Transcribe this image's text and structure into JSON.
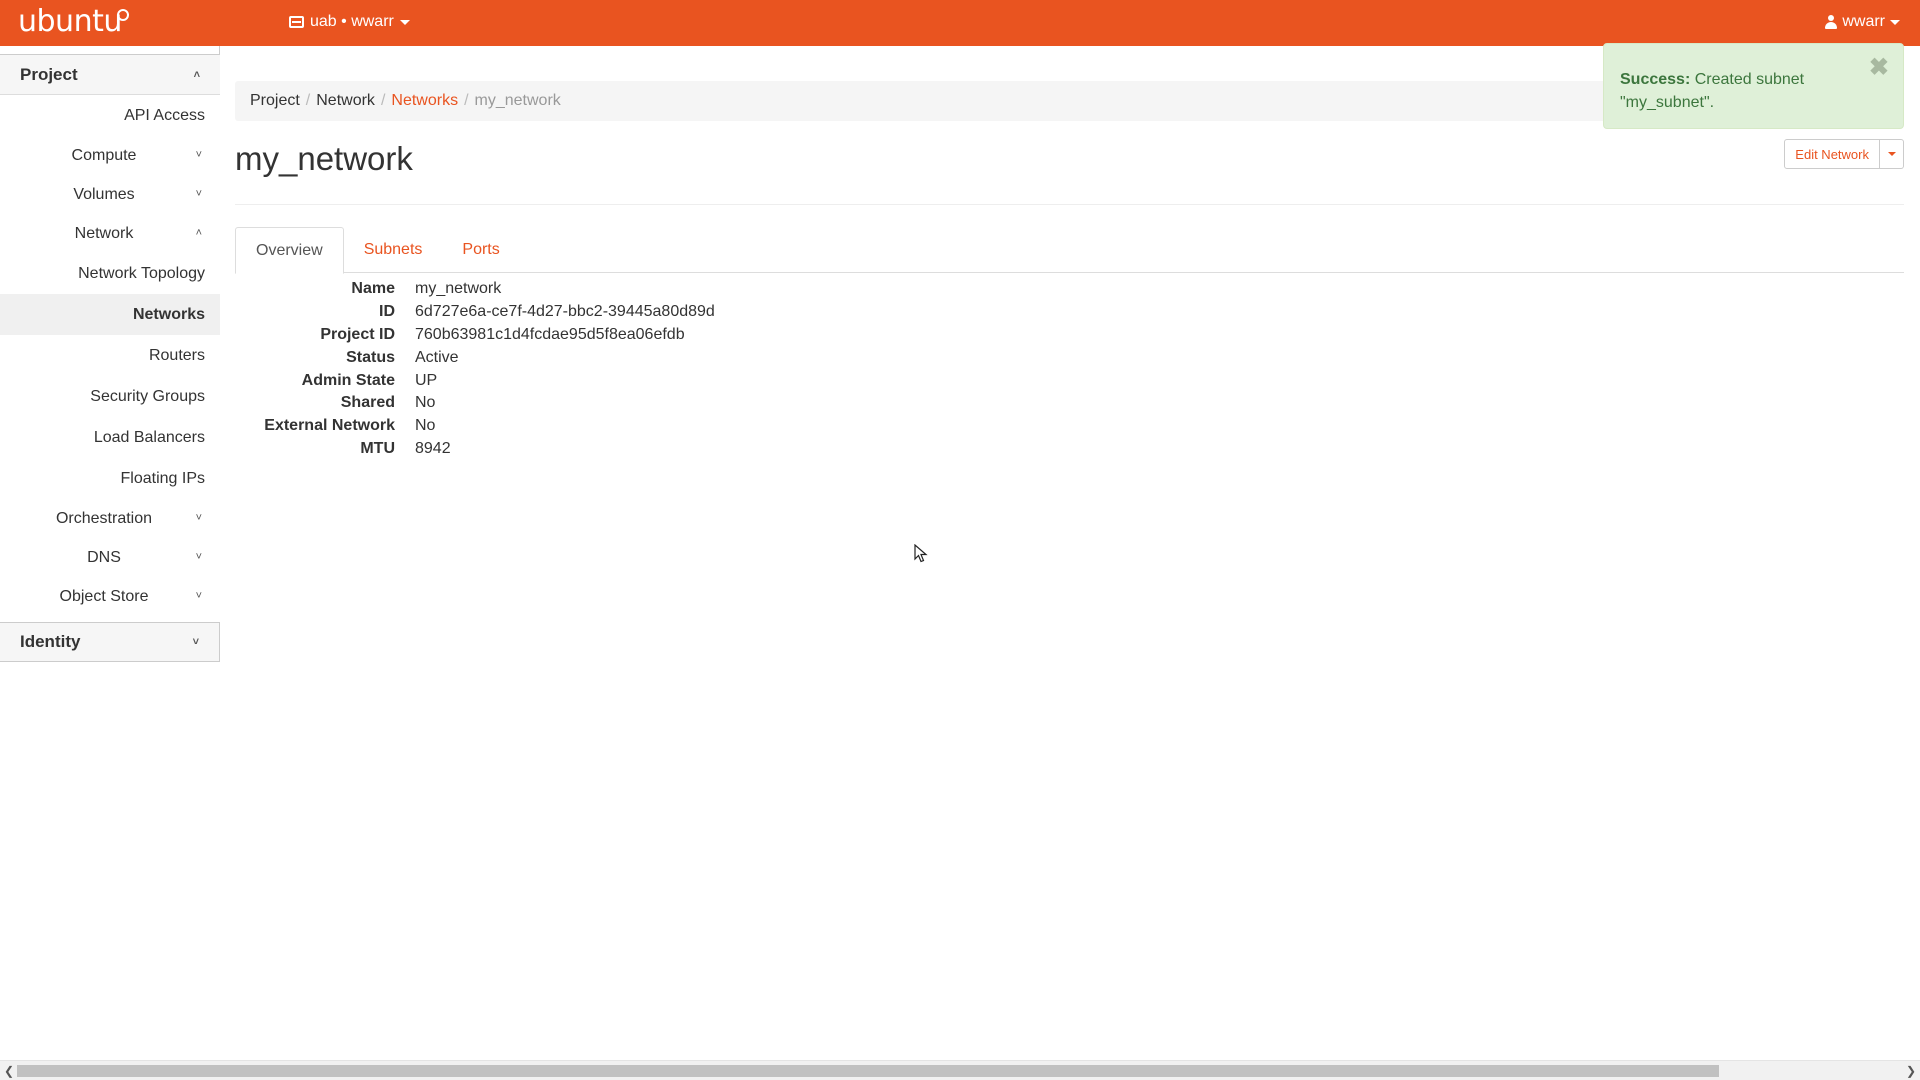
{
  "topbar": {
    "brand": "ubuntu",
    "project_switcher": "uab • wwarr",
    "user": "wwarr"
  },
  "sidebar": {
    "project_label": "Project",
    "items": [
      {
        "label": "API Access",
        "type": "item"
      },
      {
        "label": "Compute",
        "type": "group",
        "expanded": false
      },
      {
        "label": "Volumes",
        "type": "group",
        "expanded": false
      },
      {
        "label": "Network",
        "type": "group",
        "expanded": true
      },
      {
        "label": "Network Topology",
        "type": "item"
      },
      {
        "label": "Networks",
        "type": "item",
        "active": true
      },
      {
        "label": "Routers",
        "type": "item"
      },
      {
        "label": "Security Groups",
        "type": "item"
      },
      {
        "label": "Load Balancers",
        "type": "item"
      },
      {
        "label": "Floating IPs",
        "type": "item"
      },
      {
        "label": "Orchestration",
        "type": "group",
        "expanded": false
      },
      {
        "label": "DNS",
        "type": "group",
        "expanded": false
      },
      {
        "label": "Object Store",
        "type": "group",
        "expanded": false
      }
    ],
    "identity_label": "Identity"
  },
  "breadcrumb": {
    "project": "Project",
    "network": "Network",
    "networks": "Networks",
    "current": "my_network"
  },
  "page": {
    "title": "my_network",
    "edit_button": "Edit Network"
  },
  "tabs": [
    "Overview",
    "Subnets",
    "Ports"
  ],
  "details": [
    {
      "label": "Name",
      "value": "my_network"
    },
    {
      "label": "ID",
      "value": "6d727e6a-ce7f-4d27-bbc2-39445a80d89d"
    },
    {
      "label": "Project ID",
      "value": "760b63981c1d4fcdae95d5f8ea06efdb"
    },
    {
      "label": "Status",
      "value": "Active"
    },
    {
      "label": "Admin State",
      "value": "UP"
    },
    {
      "label": "Shared",
      "value": "No"
    },
    {
      "label": "External Network",
      "value": "No"
    },
    {
      "label": "MTU",
      "value": "8942"
    }
  ],
  "alert": {
    "title": "Success:",
    "message": "Created subnet \"my_subnet\"."
  },
  "colors": {
    "accent": "#e95420",
    "alert_bg": "#dff0d8",
    "alert_text": "#3c763d"
  }
}
